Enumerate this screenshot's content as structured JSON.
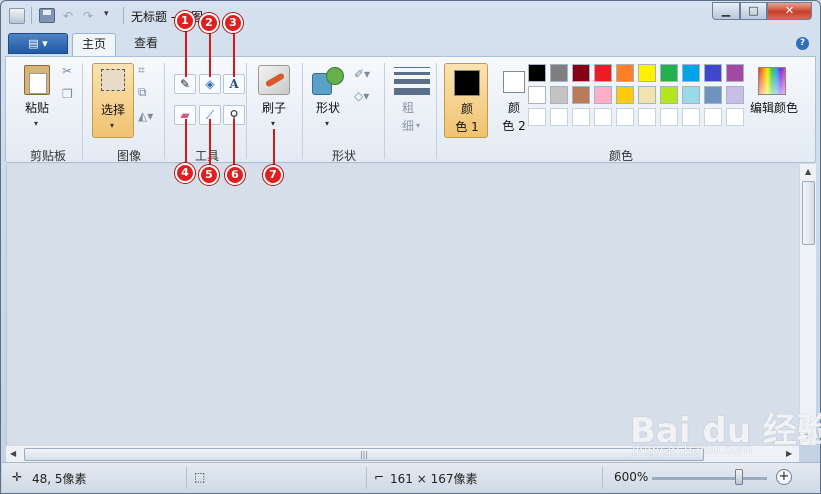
{
  "window": {
    "title": "无标题 - 画图",
    "minimize_glyph": "▁",
    "maximize_glyph": "□",
    "close_glyph": "✕"
  },
  "quick_access": {
    "undo_glyph": "↶",
    "redo_glyph": "↷",
    "dropdown_glyph": "▾"
  },
  "tabs": {
    "app_menu_glyph": "▤ ▾",
    "home": "主页",
    "view": "查看",
    "help_glyph": "?"
  },
  "ribbon": {
    "clipboard": {
      "paste": "粘贴",
      "group": "剪贴板"
    },
    "image": {
      "select": "选择",
      "group": "图像"
    },
    "tools": {
      "group": "工具",
      "text_glyph": "A"
    },
    "brushes": {
      "label": "刷子"
    },
    "shapes": {
      "label": "形状",
      "group": "形状"
    },
    "size": {
      "label_line1": "粗",
      "label_line2": "细"
    },
    "colors": {
      "color1_line1": "颜",
      "color1_line2": "色 1",
      "color2_line1": "颜",
      "color2_line2": "色 2",
      "edit": "编辑颜色",
      "group": "颜色",
      "color1": "#000000",
      "color2": "#ffffff",
      "palette_row1": [
        "#000000",
        "#7f7f7f",
        "#880015",
        "#ed1c24",
        "#ff7f27",
        "#fff200",
        "#22b14c",
        "#00a2e8",
        "#3f48cc",
        "#a349a4"
      ],
      "palette_row2": [
        "#ffffff",
        "#c3c3c3",
        "#b97a57",
        "#ffaec9",
        "#ffc90e",
        "#efe4b0",
        "#b5e61d",
        "#99d9ea",
        "#7092be",
        "#c8bfe7"
      ],
      "palette_row3": [
        "#ffffff",
        "#ffffff",
        "#ffffff",
        "#ffffff",
        "#ffffff",
        "#ffffff",
        "#ffffff",
        "#ffffff",
        "#ffffff",
        "#ffffff"
      ]
    }
  },
  "markers": [
    "1",
    "2",
    "3",
    "4",
    "5",
    "6",
    "7"
  ],
  "scroll": {
    "hgrip": "|||"
  },
  "status": {
    "cursor_pos": "48, 5像素",
    "canvas_size": "161 × 167像素",
    "zoom": "600%"
  },
  "watermark": {
    "logo": "Bai du 经验",
    "url": "jingyan.baidu.com"
  }
}
